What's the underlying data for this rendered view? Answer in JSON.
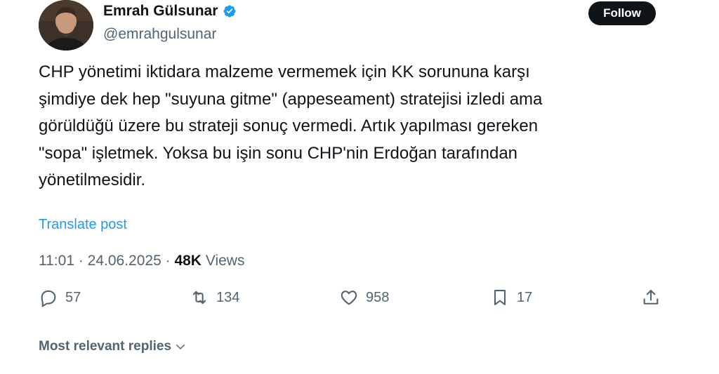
{
  "author": {
    "name": "Emrah Gülsunar",
    "handle": "@emrahgulsunar",
    "verified_color": "#1d9bf0"
  },
  "follow_label": "Follow",
  "tweet": {
    "lines": [
      "CHP yönetimi iktidara malzeme vermemek için KK sorununa karşı",
      "şimdiye dek hep \"suyuna gitme\" (appeseament) stratejisi izledi ama",
      "görüldüğü üzere bu strateji sonuç vermedi. Artık yapılması gereken",
      "\"sopa\" işletmek. Yoksa bu işin sonu CHP'nin Erdoğan tarafından",
      "yönetilmesidir."
    ]
  },
  "translate_label": "Translate post",
  "meta": {
    "time": "11:01",
    "date": "24.06.2025",
    "separator": " · ",
    "views_count": "48K",
    "views_label": " Views"
  },
  "actions": {
    "replies": "57",
    "reposts": "134",
    "likes": "958",
    "bookmarks": "17"
  },
  "replies_sort_label": "Most relevant replies",
  "colors": {
    "accent": "#1d9bf0",
    "text": "#0f1419",
    "secondary": "#536471"
  }
}
